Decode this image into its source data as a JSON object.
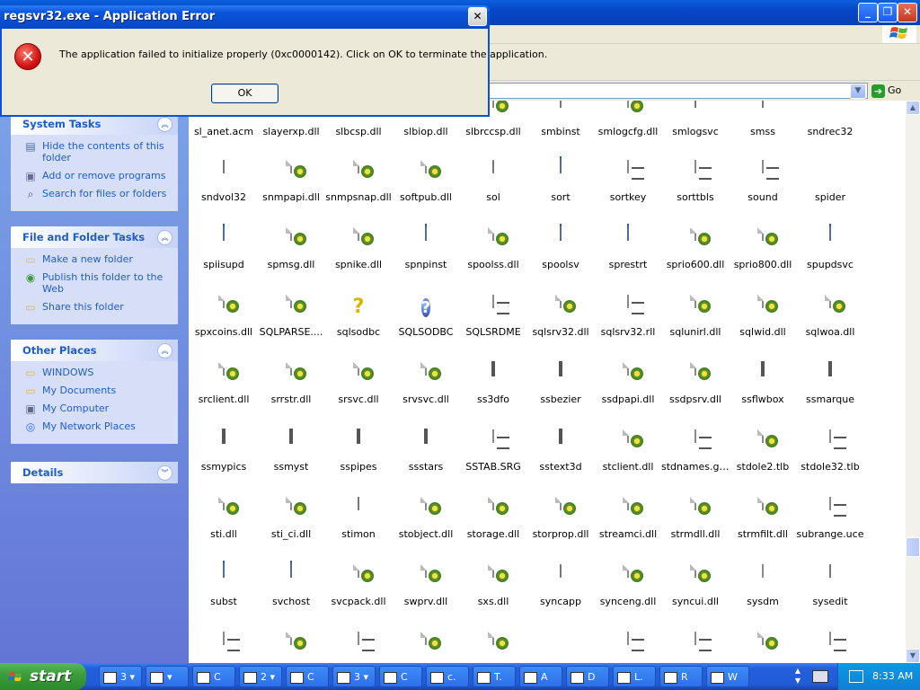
{
  "dialog": {
    "title": "regsvr32.exe - Application Error",
    "message": "The application failed to initialize properly (0xc0000142). Click on OK to terminate the application.",
    "ok_label": "OK",
    "close_glyph": "✕",
    "error_glyph": "✕"
  },
  "explorer": {
    "go_label": "Go",
    "go_glyph": "➔",
    "address_drop_glyph": "▼",
    "window_buttons": {
      "minimize": "_",
      "restore": "❐",
      "close": "✕"
    }
  },
  "task_pane": {
    "panels": [
      {
        "title": "System Tasks",
        "toggle": "︽",
        "items": [
          {
            "label": "Hide the contents of this folder",
            "icon": "hide-icon"
          },
          {
            "label": "Add or remove programs",
            "icon": "add-remove-icon"
          },
          {
            "label": "Search for files or folders",
            "icon": "search-icon"
          }
        ]
      },
      {
        "title": "File and Folder Tasks",
        "toggle": "︽",
        "items": [
          {
            "label": "Make a new folder",
            "icon": "new-folder-icon"
          },
          {
            "label": "Publish this folder to the Web",
            "icon": "publish-icon"
          },
          {
            "label": "Share this folder",
            "icon": "share-icon"
          }
        ]
      },
      {
        "title": "Other Places",
        "toggle": "︽",
        "items": [
          {
            "label": "WINDOWS",
            "icon": "folder-icon"
          },
          {
            "label": "My Documents",
            "icon": "my-documents-icon"
          },
          {
            "label": "My Computer",
            "icon": "my-computer-icon"
          },
          {
            "label": "My Network Places",
            "icon": "network-icon"
          }
        ]
      },
      {
        "title": "Details",
        "toggle": "︾",
        "items": []
      }
    ]
  },
  "files": [
    [
      "sl_anet.acm",
      "slayerxp.dll",
      "slbcsp.dll",
      "slbiop.dll",
      "slbrccsp.dll",
      "smbinst",
      "smlogcfg.dll",
      "smlogsvc",
      "smss",
      "sndrec32"
    ],
    [
      "sndvol32",
      "snmpapi.dll",
      "snmpsnap.dll",
      "softpub.dll",
      "sol",
      "sort",
      "sortkey",
      "sorttbls",
      "sound",
      "spider"
    ],
    [
      "spiisupd",
      "spmsg.dll",
      "spnike.dll",
      "spnpinst",
      "spoolss.dll",
      "spoolsv",
      "sprestrt",
      "sprio600.dll",
      "sprio800.dll",
      "spupdsvc"
    ],
    [
      "spxcoins.dll",
      "SQLPARSE....",
      "sqlsodbc",
      "SQLSODBC",
      "SQLSRDME",
      "sqlsrv32.dll",
      "sqlsrv32.rll",
      "sqlunirl.dll",
      "sqlwid.dll",
      "sqlwoa.dll"
    ],
    [
      "srclient.dll",
      "srrstr.dll",
      "srsvc.dll",
      "srvsvc.dll",
      "ss3dfo",
      "ssbezier",
      "ssdpapi.dll",
      "ssdpsrv.dll",
      "ssflwbox",
      "ssmarque"
    ],
    [
      "ssmypics",
      "ssmyst",
      "sspipes",
      "ssstars",
      "SSTAB.SRG",
      "sstext3d",
      "stclient.dll",
      "stdnames.gpd",
      "stdole2.tlb",
      "stdole32.tlb"
    ],
    [
      "sti.dll",
      "sti_ci.dll",
      "stimon",
      "stobject.dll",
      "storage.dll",
      "storprop.dll",
      "streamci.dll",
      "strmdll.dll",
      "strmfilt.dll",
      "subrange.uce"
    ],
    [
      "subst",
      "svchost",
      "svcpack.dll",
      "swprv.dll",
      "sxs.dll",
      "syncapp",
      "synceng.dll",
      "syncui.dll",
      "sysdm",
      "sysedit"
    ],
    [
      "",
      "",
      "",
      "",
      "",
      "",
      "",
      "",
      "",
      ""
    ]
  ],
  "file_icons": [
    [
      "dll",
      "dll",
      "dll",
      "dll",
      "dll",
      "blank",
      "dll",
      "blank",
      "blank",
      "speaker"
    ],
    [
      "volume",
      "dll",
      "dll",
      "dll",
      "sol",
      "app",
      "doc",
      "doc",
      "doc",
      "spider"
    ],
    [
      "app",
      "dll",
      "dll",
      "app",
      "dll",
      "app",
      "app",
      "dll",
      "dll",
      "app"
    ],
    [
      "dll",
      "dll",
      "query",
      "help",
      "notepad",
      "dll",
      "doc",
      "dll",
      "dll",
      "dll"
    ],
    [
      "dll",
      "dll",
      "dll",
      "dll",
      "screen",
      "screen-red",
      "dll",
      "dll",
      "screen",
      "screen"
    ],
    [
      "screen-grey",
      "screen",
      "screen",
      "screen",
      "doc",
      "screen",
      "dll",
      "doc",
      "dll",
      "doc"
    ],
    [
      "dll",
      "dll",
      "scanner",
      "dll",
      "dll",
      "dll",
      "dll",
      "dll",
      "dll",
      "doc"
    ],
    [
      "app",
      "app",
      "dll",
      "dll",
      "dll",
      "briefcase",
      "dll",
      "dll",
      "sysdm",
      "sysedit"
    ],
    [
      "doc",
      "dll",
      "doc",
      "dll",
      "dll",
      "cd",
      "doc",
      "doc",
      "dll",
      "doc"
    ]
  ],
  "taskbar": {
    "start_label": "start",
    "buttons": [
      {
        "label": "3 ▾",
        "icon": "folder-group-icon"
      },
      {
        "label": "▾",
        "icon": "window-icon"
      },
      {
        "label": "C",
        "icon": "cmd-icon"
      },
      {
        "label": "2 ▾",
        "icon": "window-group-icon"
      },
      {
        "label": "C",
        "icon": "cmd-icon"
      },
      {
        "label": "3 ▾",
        "icon": "app-group-icon"
      },
      {
        "label": "C",
        "icon": "window-icon"
      },
      {
        "label": "c.",
        "icon": "doc-icon"
      },
      {
        "label": "T.",
        "icon": "help-icon"
      },
      {
        "label": "A",
        "icon": "app-icon"
      },
      {
        "label": "D",
        "icon": "disk-icon"
      },
      {
        "label": "L.",
        "icon": "window-icon"
      },
      {
        "label": "R",
        "icon": "regedit-icon"
      },
      {
        "label": "W",
        "icon": "shield-icon"
      }
    ],
    "clock": "8:33 AM"
  },
  "colors": {
    "xp_blue": "#0a52d6",
    "task_pane_link": "#215dc6",
    "start_green": "#3c9e3c",
    "error_red": "#d01515"
  }
}
